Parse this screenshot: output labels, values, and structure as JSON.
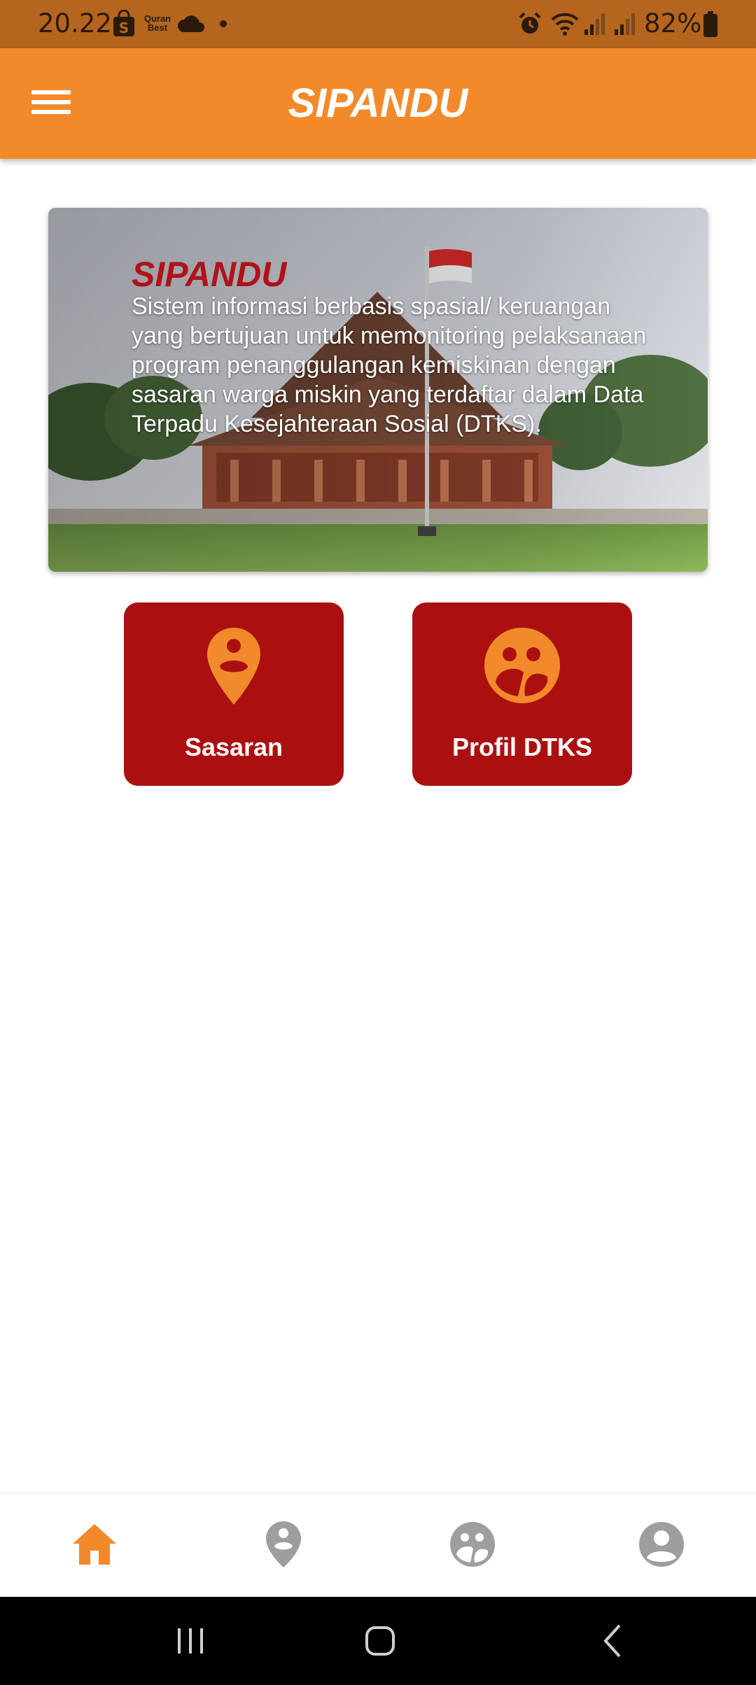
{
  "status_bar": {
    "time": "20.22",
    "quran_badge": "Quran Best",
    "battery": "82%",
    "icons": [
      "shopping-bag-icon",
      "quran-app-icon",
      "cloud-icon",
      "notification-dot",
      "alarm-icon",
      "wifi-icon",
      "signal-icon",
      "signal-icon",
      "battery-icon"
    ]
  },
  "app_bar": {
    "title": "SIPANDU",
    "menu_icon": "hamburger-menu-icon"
  },
  "banner": {
    "title": "SIPANDU",
    "description": "Sistem informasi berbasis spasial/ keruangan yang bertujuan untuk memonitoring pelaksanaan program penanggulangan kemiskinan dengan sasaran warga miskin yang terdaftar dalam Data Terpadu Kesejahteraan Sosial (DTKS)."
  },
  "tiles": [
    {
      "label": "Sasaran",
      "icon": "location-person-icon"
    },
    {
      "label": "Profil DTKS",
      "icon": "group-circle-icon"
    }
  ],
  "bottom_nav": [
    {
      "icon": "home-icon",
      "active": true
    },
    {
      "icon": "location-person-icon",
      "active": false
    },
    {
      "icon": "group-circle-icon",
      "active": false
    },
    {
      "icon": "account-circle-icon",
      "active": false
    }
  ],
  "colors": {
    "status_bar": "#b5651d",
    "app_bar": "#f28a2b",
    "tile_background": "#ab1010",
    "tile_icon": "#f28a2b",
    "banner_title": "#b0121a",
    "nav_active": "#f28a2b",
    "nav_inactive": "#9e9e9e"
  }
}
